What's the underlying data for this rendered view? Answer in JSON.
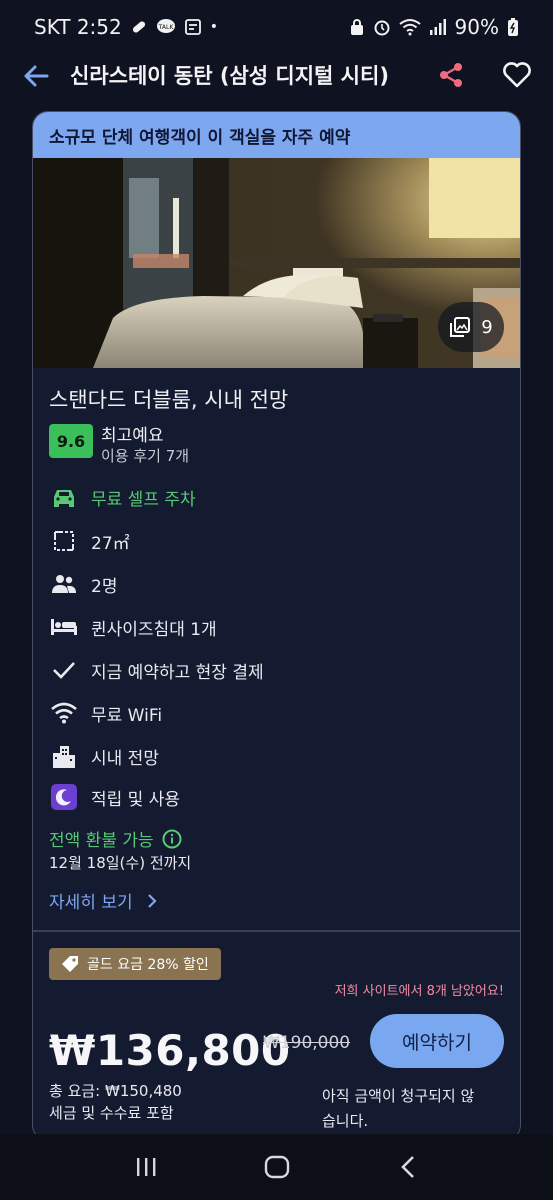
{
  "status_bar": {
    "carrier_time": "SKT 2:52",
    "battery": "90%"
  },
  "header": {
    "title": "신라스테이 동탄 (삼성 디지털 시티)"
  },
  "banner": {
    "text": "소규모 단체 여행객이 이 객실을 자주 예약"
  },
  "photo": {
    "count": "9"
  },
  "room": {
    "title": "스탠다드 더블룸, 시내 전망",
    "rating": "9.6",
    "rating_label": "최고예요",
    "review_count": "이용 후기 7개"
  },
  "amenities": [
    {
      "icon": "car-icon",
      "label": "무료 셀프 주차",
      "color": "#57c874"
    },
    {
      "icon": "area-icon",
      "label": "27㎡"
    },
    {
      "icon": "people-icon",
      "label": "2명"
    },
    {
      "icon": "bed-icon",
      "label": "퀸사이즈침대 1개"
    },
    {
      "icon": "check-icon",
      "label": "지금 예약하고 현장 결제"
    },
    {
      "icon": "wifi-icon",
      "label": "무료 WiFi"
    },
    {
      "icon": "city-icon",
      "label": "시내 전망"
    },
    {
      "icon": "moon-icon",
      "label": "적립 및 사용"
    }
  ],
  "refund": {
    "label": "전액 환불 가능",
    "deadline": "12월 18일(수) 전까지"
  },
  "more_link": "자세히 보기",
  "pricing": {
    "gold_badge": "골드 요금 28% 할인",
    "rooms_left": "저희 사이트에서 8개 남았어요!",
    "price": "₩136,800",
    "old_price": "₩190,000",
    "total": "총 요금: ₩150,480",
    "tax_note": "세금 및 수수료 포함",
    "book_label": "예약하기",
    "not_charged": "아직 금액이 청구되지 않습니다."
  },
  "colors": {
    "background": "#0f1221",
    "accent_blue": "#7da7ef",
    "green": "#57c874",
    "gold": "#8a7350",
    "pink": "#f28ca3",
    "moon_purple": "#6b3fd0"
  }
}
